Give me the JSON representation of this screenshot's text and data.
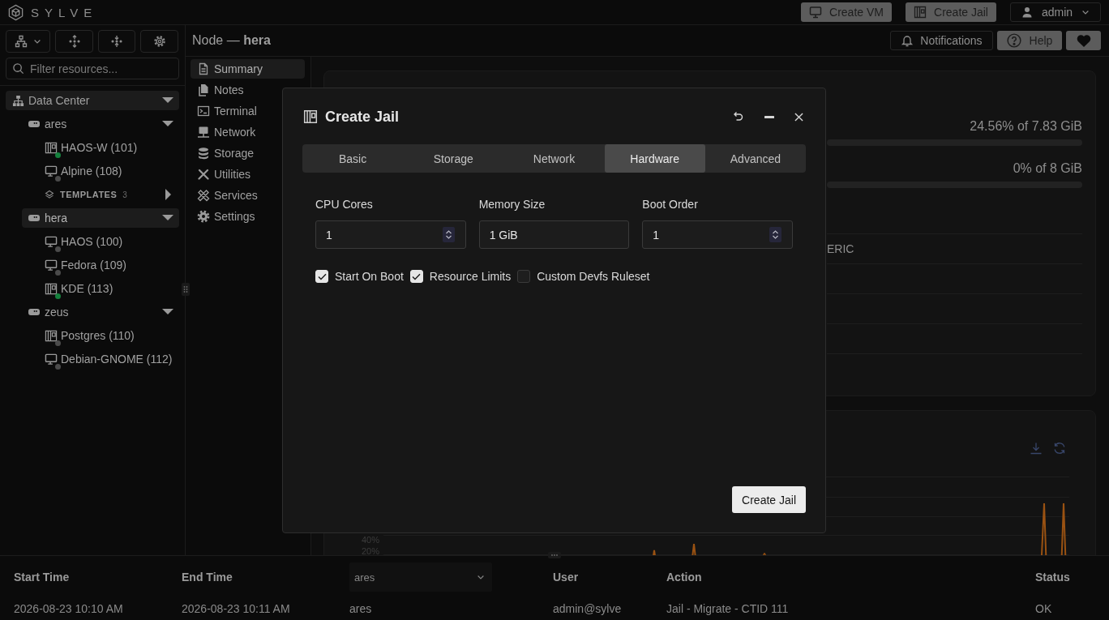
{
  "top_bar": {
    "brand": "SYLVE",
    "actions": [
      {
        "kind": "vm",
        "label": "Create VM"
      },
      {
        "kind": "jail",
        "label": "Create Jail"
      }
    ],
    "user_menu": {
      "label": "admin"
    }
  },
  "sidebar": {
    "search": {
      "placeholder": "Filter resources..."
    },
    "tree": [
      {
        "kind": "datacenter",
        "label": "Data Center",
        "expanded": true,
        "selected": false,
        "children": [
          {
            "kind": "node",
            "label": "ares",
            "expanded": true,
            "selected": false,
            "children": [
              {
                "kind": "jail",
                "label": "HAOS-W (101)",
                "selected": false,
                "color": "#15803d"
              },
              {
                "kind": "vm",
                "label": "Alpine (108)",
                "selected": false,
                "color": "#4b4b4b"
              },
              {
                "kind": "templates",
                "label": "TEMPLATES",
                "count": "3",
                "expanded": false,
                "selected": false
              }
            ]
          },
          {
            "kind": "node",
            "label": "hera",
            "expanded": true,
            "selected": true,
            "children": [
              {
                "kind": "vm",
                "label": "HAOS (100)",
                "selected": false,
                "color": "#4b4b4b"
              },
              {
                "kind": "vm",
                "label": "Fedora (109)",
                "selected": false,
                "color": "#4b4b4b"
              },
              {
                "kind": "jail",
                "label": "KDE (113)",
                "selected": false,
                "color": "#15803d"
              }
            ]
          },
          {
            "kind": "node",
            "label": "zeus",
            "expanded": true,
            "selected": false,
            "children": [
              {
                "kind": "jail",
                "label": "Postgres (110)",
                "selected": false,
                "color": "#4b4b4b"
              },
              {
                "kind": "vm",
                "label": "Debian-GNOME (112)",
                "selected": false,
                "color": "#4b4b4b"
              }
            ]
          }
        ]
      }
    ]
  },
  "main": {
    "title": "Node — **hera**",
    "actions": [
      {
        "kind": "notifications",
        "label": "Notifications"
      },
      {
        "kind": "help",
        "label": "Help"
      },
      {
        "kind": "favorite"
      }
    ],
    "nav": [
      {
        "kind": "summary",
        "label": "Summary",
        "selected": true
      },
      {
        "kind": "notes",
        "label": "Notes",
        "selected": false
      },
      {
        "kind": "terminal",
        "label": "Terminal",
        "selected": false
      },
      {
        "kind": "network",
        "label": "Network",
        "selected": false
      },
      {
        "kind": "storage",
        "label": "Storage",
        "selected": false
      },
      {
        "kind": "utilities",
        "label": "Utilities",
        "selected": false
      },
      {
        "kind": "services",
        "label": "Services",
        "selected": false
      },
      {
        "kind": "settings",
        "label": "Settings",
        "selected": false
      }
    ],
    "summary_card": {
      "usage": [
        {
          "reading": "24.56% of 7.83 GiB"
        },
        {
          "reading": "0% of 8 GiB"
        }
      ],
      "details": [
        "ERIC"
      ]
    },
    "chart_card": {
      "y_tick_labels": [
        "40%",
        "20%"
      ]
    }
  },
  "dialog": {
    "title": "Create Jail",
    "tabs": [
      {
        "label": "Basic",
        "selected": false
      },
      {
        "label": "Storage",
        "selected": false
      },
      {
        "label": "Network",
        "selected": false
      },
      {
        "label": "Hardware",
        "selected": true
      },
      {
        "label": "Advanced",
        "selected": false
      }
    ],
    "fields": [
      {
        "kind": "number",
        "label": "CPU Cores",
        "value": "1"
      },
      {
        "kind": "text",
        "label": "Memory Size",
        "value": "1 GiB"
      },
      {
        "kind": "number",
        "label": "Boot Order",
        "value": "1"
      }
    ],
    "options": [
      {
        "label": "Start On Boot",
        "checked": true
      },
      {
        "label": "Resource Limits",
        "checked": true
      },
      {
        "label": "Custom Devfs Ruleset",
        "checked": false
      }
    ],
    "submit": "Create Jail"
  },
  "audit_log": {
    "columns": [
      {
        "kind": "text",
        "label": "Start Time"
      },
      {
        "kind": "text",
        "label": "End Time"
      },
      {
        "kind": "select",
        "value": "ares"
      },
      {
        "kind": "text",
        "label": "User"
      },
      {
        "kind": "text",
        "label": "Action"
      },
      {
        "kind": "text",
        "label": "Status"
      }
    ],
    "rows": [
      [
        "2026-08-23 10:10 AM",
        "2026-08-23 10:11 AM",
        "ares",
        "admin@sylve",
        "Jail - Migrate - CTID 111",
        "OK"
      ]
    ]
  }
}
